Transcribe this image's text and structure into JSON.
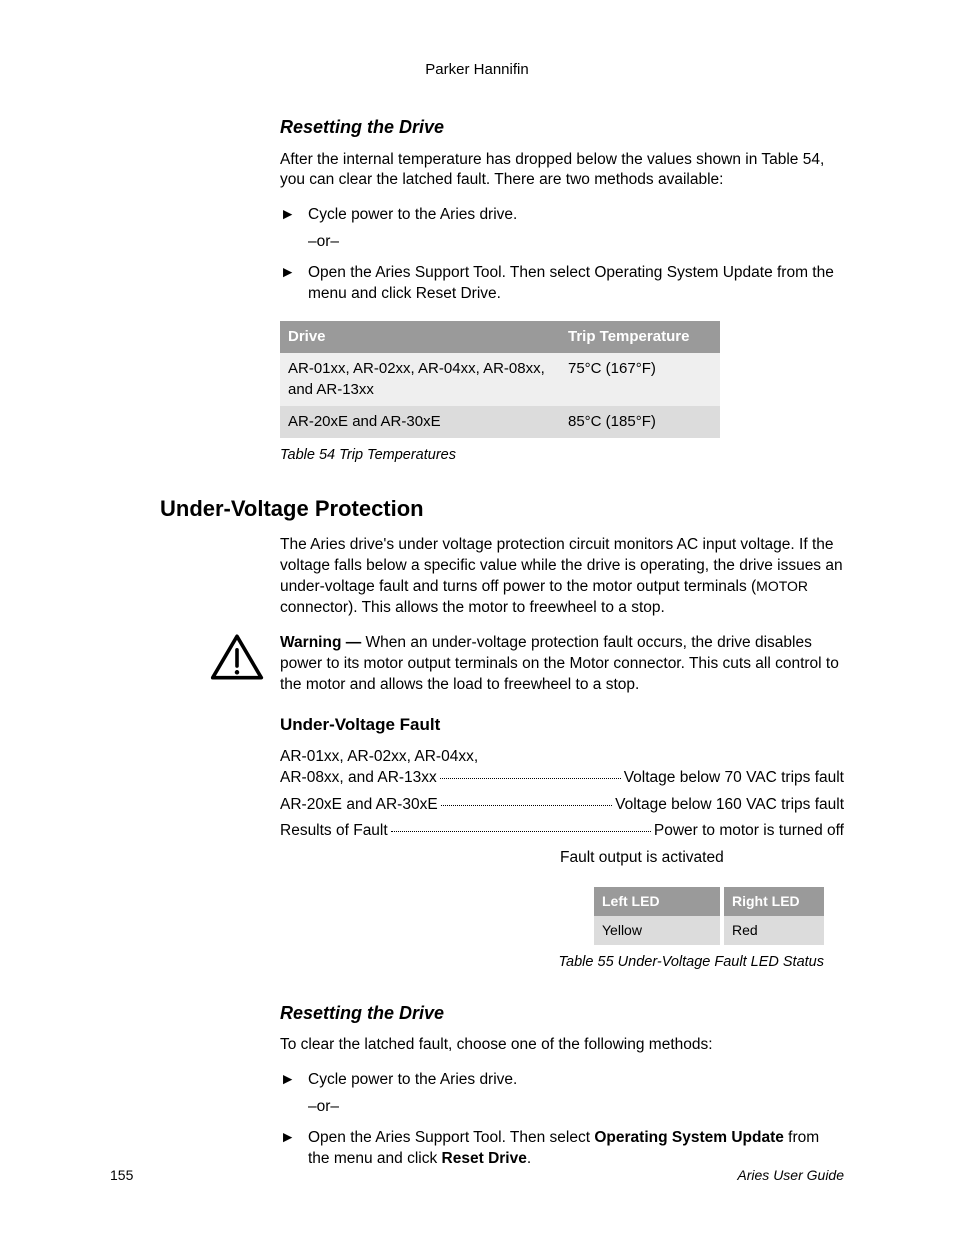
{
  "header": "Parker Hannifin",
  "sec1": {
    "title": "Resetting the Drive",
    "p1": "After the internal temperature has dropped below the values shown in Table 54, you can clear the latched fault. There are two methods available:",
    "b1": "Cycle power to the Aries drive.",
    "or": "–or–",
    "b2": "Open the Aries Support Tool. Then select Operating System Update from the menu and click Reset Drive."
  },
  "table1": {
    "h1": "Drive",
    "h2": "Trip Temperature",
    "r1c1": "AR-01xx, AR-02xx, AR-04xx, AR-08xx, and AR-13xx",
    "r1c2": "75°C (167°F)",
    "r2c1": "AR-20xE and AR-30xE",
    "r2c2": "85°C (185°F)",
    "caption": "Table 54 Trip Temperatures"
  },
  "sec2": {
    "heading": "Under-Voltage Protection",
    "p1a": "The Aries drive's under voltage protection circuit monitors AC input voltage. If the voltage falls below a specific value while the drive is operating, the drive issues an under-voltage fault and turns off power to the motor output terminals (",
    "p1b": "MOTOR",
    "p1c": " connector). This allows the motor to freewheel to a stop.",
    "warn_label": "Warning —",
    "warn_text": " When an under-voltage protection fault occurs, the drive disables power to its motor output terminals on the Motor connector. This cuts all control to the motor and allows the load to freewheel to a stop."
  },
  "sec3": {
    "title": "Under-Voltage Fault",
    "row1_label_a": "AR-01xx, AR-02xx, AR-04xx,",
    "row1_label_b": "AR-08xx, and AR-13xx",
    "row1_value": "Voltage below 70 VAC trips fault",
    "row2_label": "AR-20xE and AR-30xE",
    "row2_value": "Voltage below 160 VAC trips fault",
    "row3_label": "Results of Fault",
    "row3_value": "Power to motor is turned off",
    "row3_extra": "Fault output is activated"
  },
  "table2": {
    "h1": "Left LED",
    "h2": "Right LED",
    "c1": "Yellow",
    "c2": "Red",
    "caption": "Table 55 Under-Voltage Fault LED Status"
  },
  "sec4": {
    "title": "Resetting the Drive",
    "p1": "To clear the latched fault, choose one of the following methods:",
    "b1": "Cycle power to the Aries drive.",
    "or": "–or–",
    "b2a": "Open the Aries Support Tool. Then select ",
    "b2b": "Operating System Update",
    "b2c": " from the menu and click ",
    "b2d": "Reset Drive",
    "b2e": "."
  },
  "footer": {
    "page": "155",
    "title": "Aries User Guide"
  },
  "marker": "►"
}
